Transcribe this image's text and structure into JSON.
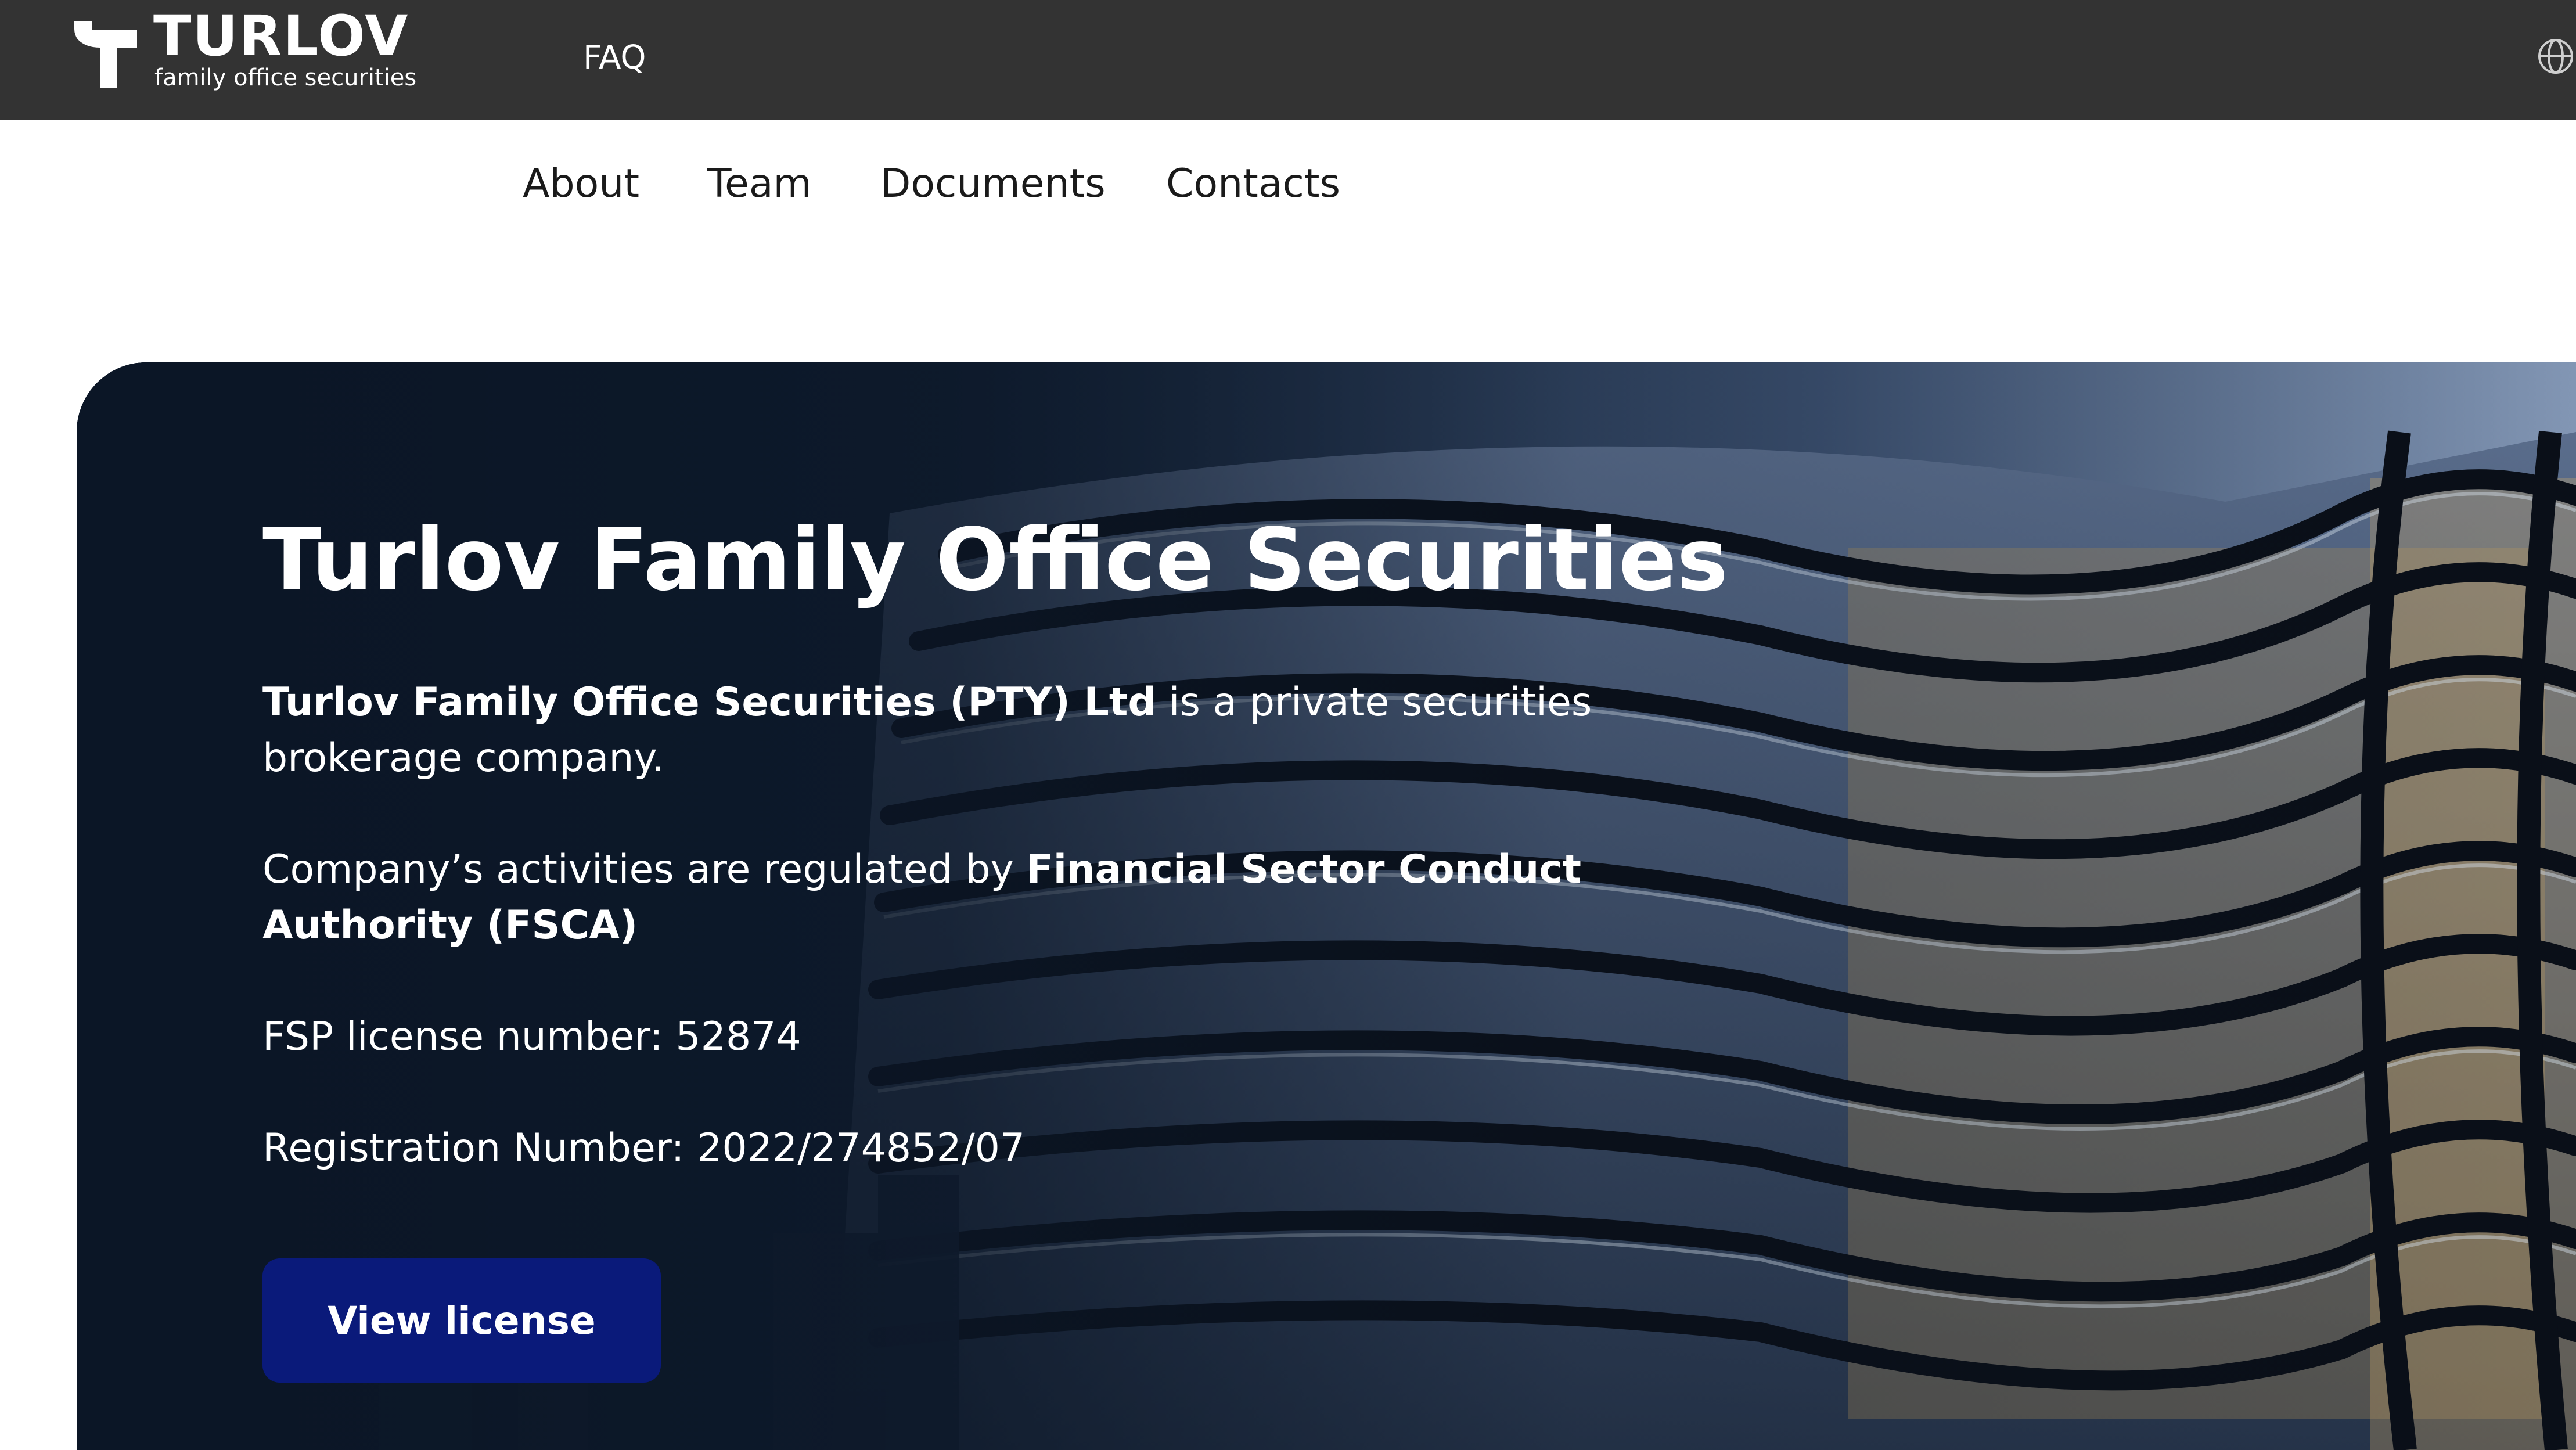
{
  "header": {
    "logo_word": "TURLOV",
    "logo_tagline": "family office securities",
    "faq_label": "FAQ",
    "language_icon": "globe-icon"
  },
  "subnav": {
    "items": [
      {
        "label": "About"
      },
      {
        "label": "Team"
      },
      {
        "label": "Documents"
      },
      {
        "label": "Contacts"
      }
    ]
  },
  "hero": {
    "title": "Turlov Family Office Securities",
    "intro_bold": "Turlov Family Office Securities (PTY) Ltd",
    "intro_rest": " is a private securities brokerage company.",
    "regulated_prefix": "Company’s activities are regulated by ",
    "regulator_bold": "Financial Sector Conduct Authority (FSCA)",
    "fsp_license": "FSP license number: 52874",
    "registration": "Registration Number: 2022/274852/07",
    "button_label": "View license"
  },
  "colors": {
    "topbar": "#333333",
    "button": "#0a1a7a",
    "hero_dark": "#0c1a2c"
  }
}
